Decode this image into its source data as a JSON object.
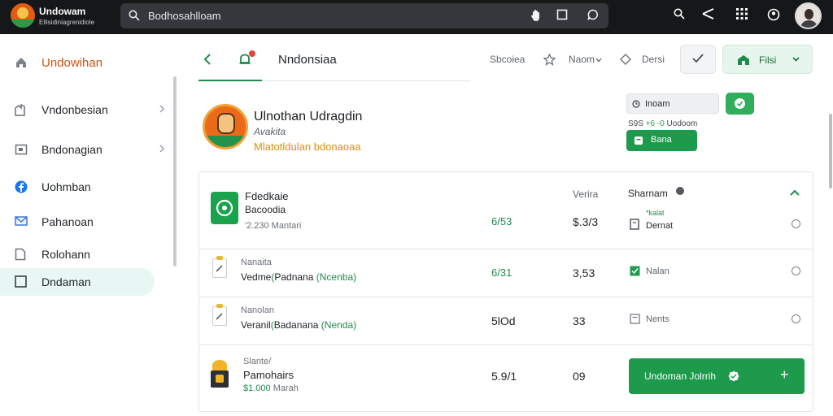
{
  "app": {
    "name": "Undowam",
    "subtitle": "Ellisidiniagrenidiole"
  },
  "search": {
    "value": "Bodhosahlloam"
  },
  "sidebar": {
    "items": [
      {
        "label": "Undowihan"
      },
      {
        "label": "Vndonbesian"
      },
      {
        "label": "Bndonagian"
      },
      {
        "label": "Uohmban"
      },
      {
        "label": "Pahanoan"
      },
      {
        "label": "Rolohann"
      },
      {
        "label": "Dndaman"
      }
    ]
  },
  "header": {
    "title": "Nndonsiaa",
    "actions": {
      "status": "Sbcoiea",
      "menu": "Naom",
      "version": "Dersi"
    },
    "files_label": "Filsi"
  },
  "profile": {
    "name": "Ulnothan Udragdin",
    "subtitle": "Avakita",
    "tagline": "Mlatotldulan bdonaoaa"
  },
  "right_panel": {
    "input_value": "Inoam",
    "meta_prefix": "S9S",
    "meta_delta": "+6 -0",
    "meta_text": "Uodoom",
    "button_label": "Bana"
  },
  "table": {
    "header": {
      "col1": "Verira",
      "col2": "Sharnam"
    },
    "rows": [
      {
        "title": "Fdedkaie",
        "subtitle": "Bacoodia",
        "meta": "'2.230 Mantari",
        "value1": "6/53",
        "value2": "$.3/3",
        "status_top": "*kalat",
        "status": "Dernat"
      },
      {
        "title": "Nanaita",
        "subtitle_a": "Vedme",
        "subtitle_b": "Padnana",
        "subtitle_c": "Ncenba",
        "value1": "6/31",
        "value2": "3,53",
        "status": "Nalan"
      },
      {
        "title": "Nanolan",
        "subtitle_a": "Veranil",
        "subtitle_b": "Badanana",
        "subtitle_c": "Nenda",
        "value1": "5lOd",
        "value2": "33",
        "status": "Nents"
      },
      {
        "title": "Slante/",
        "subtitle": "Pamohairs",
        "meta_num": "$1.000",
        "meta_unit": "Marah",
        "value1": "5.9/1",
        "value2": "09",
        "cta_label": "Undoman Jolrrih",
        "cta_plus": "+"
      }
    ]
  },
  "colors": {
    "topbar": "#151718",
    "accent_green": "#1d9a4c",
    "brand_orange": "#e25b12",
    "active_bg": "#e8f7f3"
  }
}
